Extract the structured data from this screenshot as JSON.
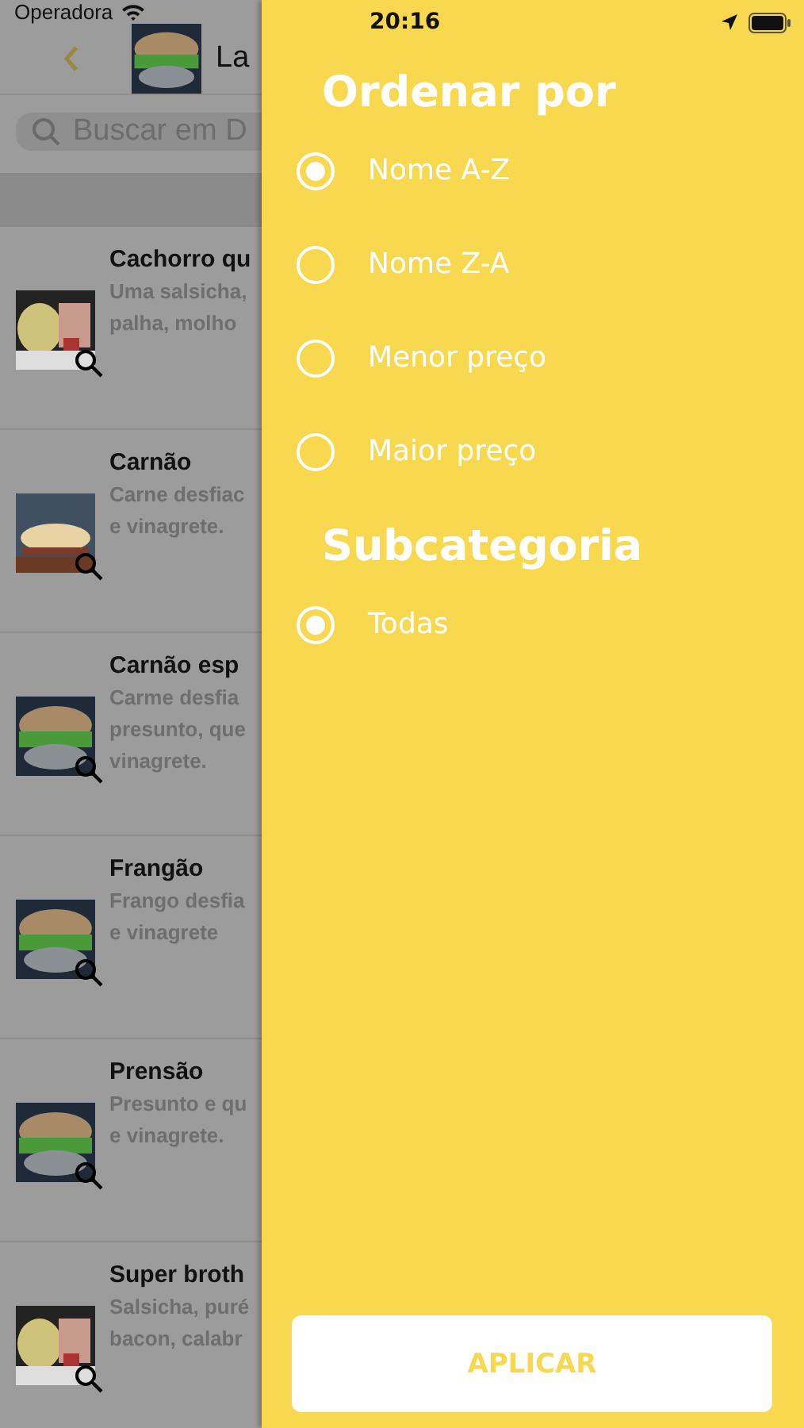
{
  "status_bar": {
    "carrier": "Operadora",
    "time": "20:16"
  },
  "header": {
    "title": "La"
  },
  "search": {
    "placeholder": "Buscar em D"
  },
  "products": [
    {
      "title": "Cachorro qu",
      "description": "Uma salsicha,\npalha, molho"
    },
    {
      "title": "Carnão",
      "description": "Carne desfiac\ne vinagrete."
    },
    {
      "title": "Carnão esp",
      "description": "Carme desfia\npresunto, que\nvinagrete."
    },
    {
      "title": "Frangão",
      "description": "Frango desfia\ne vinagrete"
    },
    {
      "title": "Prensão",
      "description": "Presunto e qu\ne vinagrete."
    },
    {
      "title": "Super broth",
      "description": "Salsicha, puré\nbacon, calabr"
    }
  ],
  "drawer": {
    "sections": [
      {
        "heading": "Ordenar por",
        "options": [
          {
            "label": "Nome A-Z",
            "selected": true
          },
          {
            "label": "Nome Z-A",
            "selected": false
          },
          {
            "label": "Menor preço",
            "selected": false
          },
          {
            "label": "Maior preço",
            "selected": false
          }
        ]
      },
      {
        "heading": "Subcategoria",
        "options": [
          {
            "label": "Todas",
            "selected": true
          }
        ]
      }
    ],
    "apply_button": "APLICAR"
  }
}
